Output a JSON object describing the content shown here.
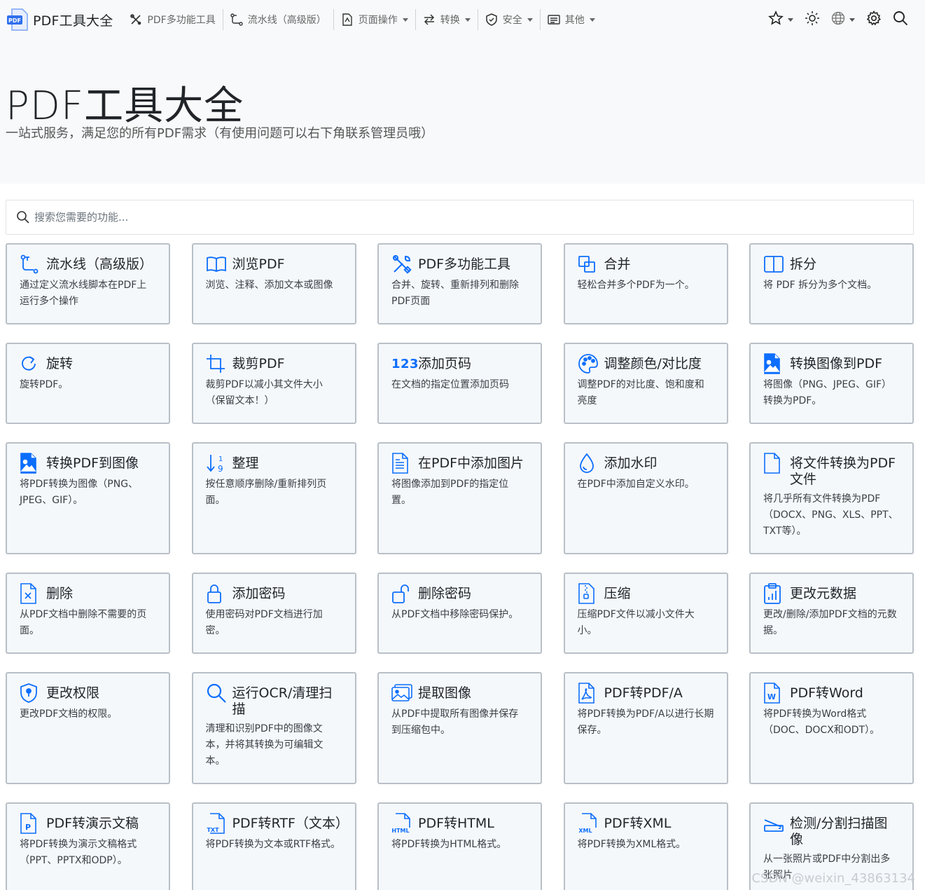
{
  "brand": {
    "title": "PDF工具大全",
    "logo_text": "PDF"
  },
  "nav": {
    "items": [
      {
        "label": "PDF多功能工具",
        "icon": "tools-icon",
        "dropdown": false
      },
      {
        "label": "流水线（高级版）",
        "icon": "pipeline-icon",
        "dropdown": false
      },
      {
        "label": "页面操作",
        "icon": "file-icon",
        "dropdown": true
      },
      {
        "label": "转换",
        "icon": "arrows-icon",
        "dropdown": true
      },
      {
        "label": "安全",
        "icon": "shield-icon",
        "dropdown": true
      },
      {
        "label": "其他",
        "icon": "card-icon",
        "dropdown": true
      }
    ],
    "right_icons": [
      "star-icon",
      "sun-icon",
      "globe-icon",
      "gear-icon",
      "search-icon"
    ]
  },
  "hero": {
    "title": "PDF工具大全",
    "subtitle": "一站式服务，满足您的所有PDF需求（有使用问题可以右下角联系管理员哦）"
  },
  "search": {
    "placeholder": "搜索您需要的功能..."
  },
  "tools": [
    {
      "title": "流水线（高级版）",
      "desc": "通过定义流水线脚本在PDF上运行多个操作",
      "icon": "pipeline-icon"
    },
    {
      "title": "浏览PDF",
      "desc": "浏览、注释、添加文本或图像",
      "icon": "book-icon"
    },
    {
      "title": "PDF多功能工具",
      "desc": "合并、旋转、重新排列和删除PDF页面",
      "icon": "tools-icon"
    },
    {
      "title": "合并",
      "desc": "轻松合并多个PDF为一个。",
      "icon": "merge-icon"
    },
    {
      "title": "拆分",
      "desc": "将 PDF 拆分为多个文档。",
      "icon": "split-icon"
    },
    {
      "title": "旋转",
      "desc": "旋转PDF。",
      "icon": "rotate-icon"
    },
    {
      "title": "裁剪PDF",
      "desc": "裁剪PDF以减小其文件大小（保留文本！）",
      "icon": "crop-icon"
    },
    {
      "title": "添加页码",
      "desc": "在文档的指定位置添加页码",
      "icon": "numbers-icon",
      "icon_text": "123"
    },
    {
      "title": "调整颜色/对比度",
      "desc": "调整PDF的对比度、饱和度和亮度",
      "icon": "palette-icon"
    },
    {
      "title": "转换图像到PDF",
      "desc": "将图像（PNG、JPEG、GIF）转换为PDF。",
      "icon": "image-file-icon"
    },
    {
      "title": "转换PDF到图像",
      "desc": "将PDF转换为图像（PNG、JPEG、GIF）。",
      "icon": "image-file-icon"
    },
    {
      "title": "整理",
      "desc": "按任意顺序删除/重新排列页面。",
      "icon": "sort-icon"
    },
    {
      "title": "在PDF中添加图片",
      "desc": "将图像添加到PDF的指定位置。",
      "icon": "file-text-icon"
    },
    {
      "title": "添加水印",
      "desc": "在PDF中添加自定义水印。",
      "icon": "droplet-icon"
    },
    {
      "title": "将文件转换为PDF文件",
      "desc": "将几乎所有文件转换为PDF（DOCX、PNG、XLS、PPT、TXT等）。",
      "icon": "blank-file-icon"
    },
    {
      "title": "删除",
      "desc": "从PDF文档中删除不需要的页面。",
      "icon": "file-x-icon"
    },
    {
      "title": "添加密码",
      "desc": "使用密码对PDF文档进行加密。",
      "icon": "lock-icon"
    },
    {
      "title": "删除密码",
      "desc": "从PDF文档中移除密码保护。",
      "icon": "unlock-icon"
    },
    {
      "title": "压缩",
      "desc": "压缩PDF文件以减小文件大小。",
      "icon": "zip-file-icon"
    },
    {
      "title": "更改元数据",
      "desc": "更改/删除/添加PDF文档的元数据。",
      "icon": "clipboard-chart-icon"
    },
    {
      "title": "更改权限",
      "desc": "更改PDF文档的权限。",
      "icon": "shield-lock-icon"
    },
    {
      "title": "运行OCR/清理扫描",
      "desc": "清理和识别PDF中的图像文本，并将其转换为可编辑文本。",
      "icon": "search-icon"
    },
    {
      "title": "提取图像",
      "desc": "从PDF中提取所有图像并保存到压缩包中。",
      "icon": "images-icon"
    },
    {
      "title": "PDF转PDF/A",
      "desc": "将PDF转换为PDF/A以进行长期保存。",
      "icon": "pdf-file-icon"
    },
    {
      "title": "PDF转Word",
      "desc": "将PDF转换为Word格式（DOC、DOCX和ODT）。",
      "icon": "word-file-icon",
      "icon_text": "W"
    },
    {
      "title": "PDF转演示文稿",
      "desc": "将PDF转换为演示文稿格式（PPT、PPTX和ODP）。",
      "icon": "ppt-file-icon",
      "icon_text": "P"
    },
    {
      "title": "PDF转RTF（文本）",
      "desc": "将PDF转换为文本或RTF格式。",
      "icon": "txt-file-icon",
      "icon_text": "TXT"
    },
    {
      "title": "PDF转HTML",
      "desc": "将PDF转换为HTML格式。",
      "icon": "html-file-icon",
      "icon_text": "HTML"
    },
    {
      "title": "PDF转XML",
      "desc": "将PDF转换为XML格式。",
      "icon": "xml-file-icon",
      "icon_text": "XML"
    },
    {
      "title": "检测/分割扫描图像",
      "desc": "从一张照片或PDF中分割出多张照片",
      "icon": "scanner-icon"
    }
  ],
  "watermark": "CSDN @weixin_43863134"
}
